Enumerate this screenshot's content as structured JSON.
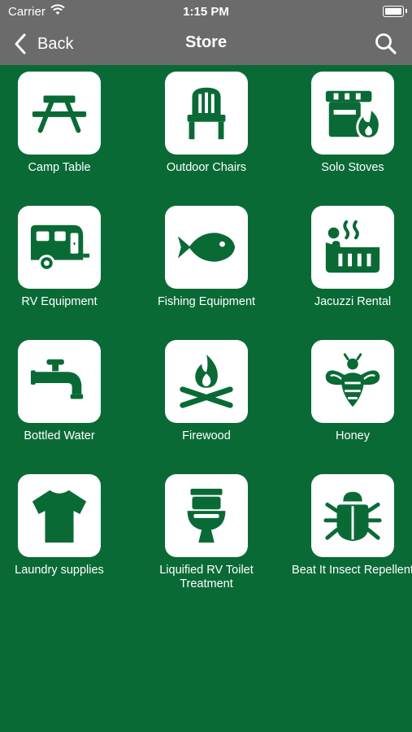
{
  "status": {
    "carrier": "Carrier",
    "time": "1:15 PM"
  },
  "nav": {
    "back_label": "Back",
    "title": "Store"
  },
  "theme": {
    "background": "#0a6a36",
    "navbar": "#6b6b6b",
    "icon": "#0a6a36",
    "tile": "#ffffff"
  },
  "items": [
    {
      "label": "Camp Table",
      "icon": "picnic-table-icon"
    },
    {
      "label": "Outdoor Chairs",
      "icon": "chair-icon"
    },
    {
      "label": "Solo Stoves",
      "icon": "stove-fire-icon"
    },
    {
      "label": "RV Equipment",
      "icon": "rv-trailer-icon"
    },
    {
      "label": "Fishing Equipment",
      "icon": "fish-icon"
    },
    {
      "label": "Jacuzzi Rental",
      "icon": "hot-tub-icon"
    },
    {
      "label": "Bottled Water",
      "icon": "faucet-icon"
    },
    {
      "label": "Firewood",
      "icon": "campfire-icon"
    },
    {
      "label": "Honey",
      "icon": "bee-icon"
    },
    {
      "label": "Laundry supplies",
      "icon": "tshirt-icon"
    },
    {
      "label": "Liquified RV Toilet Treatment",
      "icon": "toilet-icon"
    },
    {
      "label": "Beat It Insect Repellent",
      "icon": "bug-icon"
    }
  ]
}
